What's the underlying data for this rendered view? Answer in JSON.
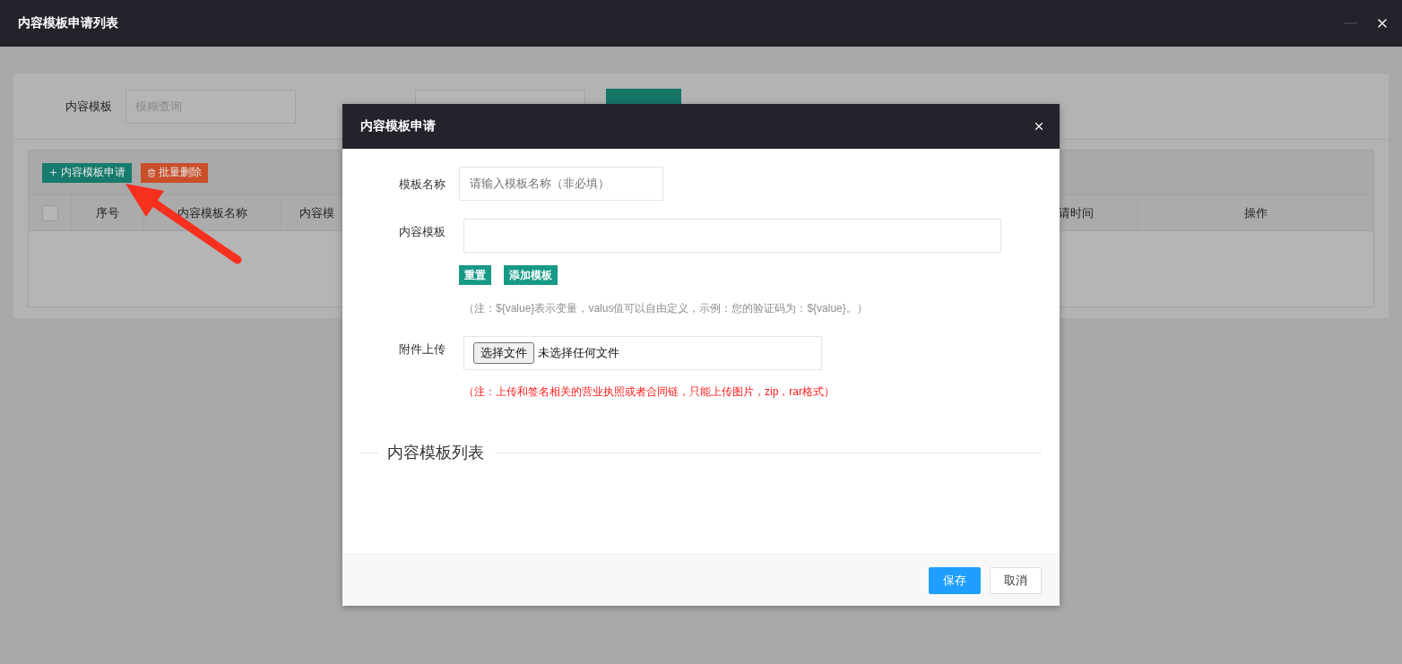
{
  "window": {
    "title": "内容模板申请列表"
  },
  "search": {
    "fields": [
      {
        "label": "内容模板",
        "kind": "text",
        "placeholder": "模糊查询"
      },
      {
        "kind": "select"
      }
    ]
  },
  "toolbar": {
    "buttons": [
      {
        "label": "内容模板申请",
        "kind": "add"
      },
      {
        "label": "批量删除",
        "kind": "delete"
      }
    ]
  },
  "table": {
    "select_all": {
      "checked": false
    },
    "columns": [
      "序号",
      "内容模板名称",
      "内容模",
      "请时间",
      "操作"
    ]
  },
  "dialog": {
    "title": "内容模板申请",
    "name_field": {
      "label": "模板名称",
      "placeholder": "请输入模板名称（非必填）"
    },
    "content_field": {
      "label": "内容模板"
    },
    "content_buttons": [
      "重置",
      "添加模板"
    ],
    "content_note": "（注：${value}表示变量，valus值可以自由定义，示例：您的验证码为：${value}。）",
    "upload": {
      "label": "附件上传",
      "button": "选择文件",
      "status": "未选择任何文件",
      "note": "（注：上传和签名相关的营业执照或者合同链，只能上传图片，zip，rar格式）"
    },
    "section_title": "内容模板列表",
    "footer_buttons": [
      {
        "label": "保存",
        "kind": "primary"
      },
      {
        "label": "取消",
        "kind": "default"
      }
    ]
  }
}
